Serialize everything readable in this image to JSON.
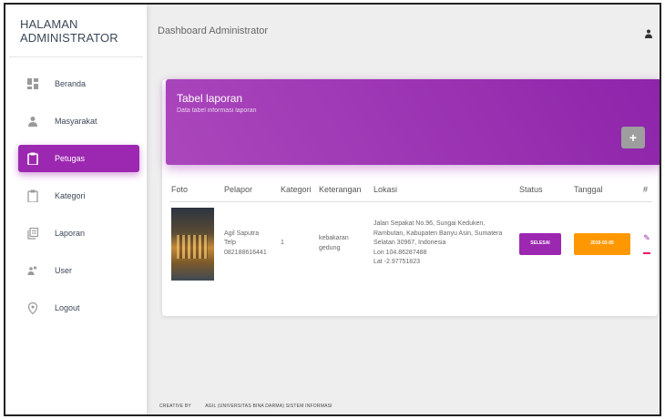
{
  "sidebar": {
    "brand": "HALAMAN ADMINISTRATOR",
    "items": [
      {
        "label": "Beranda",
        "icon": "dashboard-icon"
      },
      {
        "label": "Masyarakat",
        "icon": "person-icon"
      },
      {
        "label": "Petugas",
        "icon": "clipboard-icon",
        "active": true
      },
      {
        "label": "Kategori",
        "icon": "clipboard-outline-icon"
      },
      {
        "label": "Laporan",
        "icon": "library-books-icon"
      },
      {
        "label": "User",
        "icon": "users-icon"
      },
      {
        "label": "Logout",
        "icon": "location-pin-icon"
      }
    ]
  },
  "topbar": {
    "title": "Dashboard Administrator",
    "user_icon": "person-icon"
  },
  "card": {
    "title": "Tabel laporan",
    "subtitle": "Data tabel informasi laporan",
    "add_label": "+",
    "columns": [
      "Foto",
      "Pelapor",
      "Kategori",
      "Keterangan",
      "Lokasi",
      "Status",
      "Tanggal",
      "#"
    ],
    "rows": [
      {
        "pelapor_name": "Agil Saputra",
        "pelapor_telp": "Telp",
        "pelapor_phone": "082188616441",
        "kategori": "1",
        "keterangan_1": "kebakaran",
        "keterangan_2": "gedung",
        "lokasi_1": "Jalan Sepakat No.96, Sungai Keduken,",
        "lokasi_2": "Rambutan, Kabupaten Banyu Asin, Sumatera",
        "lokasi_3": "Selatan 30967, Indonesia",
        "lokasi_4": "Lon 104.86287488",
        "lokasi_5": "Lat -2.97751823",
        "status": "SELESAI",
        "tanggal": "2019-02-05"
      }
    ]
  },
  "footer": {
    "left": "CREATIVE BY",
    "right": "AGIL (UNIVERSITAS BINA DARMA) SISTEM INFORMASI"
  },
  "colors": {
    "accent": "#9c27b0",
    "warning": "#ff9800",
    "danger": "#e91e63"
  }
}
